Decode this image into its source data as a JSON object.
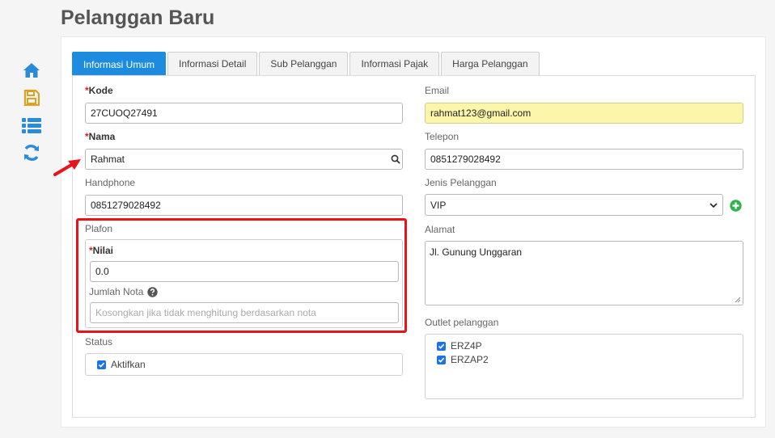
{
  "title": "Pelanggan Baru",
  "sidebar": {
    "icons": [
      "home-icon",
      "save-icon",
      "list-icon",
      "refresh-icon"
    ]
  },
  "tabs": [
    {
      "label": "Informasi Umum",
      "active": true
    },
    {
      "label": "Informasi Detail"
    },
    {
      "label": "Sub Pelanggan"
    },
    {
      "label": "Informasi Pajak"
    },
    {
      "label": "Harga Pelanggan"
    }
  ],
  "form": {
    "kode": {
      "label": "Kode",
      "value": "27CUOQ27491"
    },
    "nama": {
      "label": "Nama",
      "value": "Rahmat"
    },
    "handphone": {
      "label": "Handphone",
      "value": "0851279028492"
    },
    "plafon": {
      "label": "Plafon",
      "nilai": {
        "label": "Nilai",
        "value": "0.0"
      },
      "jumlah_nota": {
        "label": "Jumlah Nota",
        "placeholder": "Kosongkan jika tidak menghitung berdasarkan nota"
      }
    },
    "status": {
      "label": "Status",
      "checkbox_label": "Aktifkan",
      "checked": true
    },
    "email": {
      "label": "Email",
      "value": "rahmat123@gmail.com"
    },
    "telepon": {
      "label": "Telepon",
      "value": "0851279028492"
    },
    "jenis_pelanggan": {
      "label": "Jenis Pelanggan",
      "value": "VIP"
    },
    "alamat": {
      "label": "Alamat",
      "value": "Jl. Gunung Unggaran"
    },
    "outlet": {
      "label": "Outlet pelanggan",
      "items": [
        {
          "label": "ERZ4P",
          "checked": true
        },
        {
          "label": "ERZAP2",
          "checked": true
        }
      ]
    }
  },
  "required_mark": "*",
  "colors": {
    "accent": "#1d8ce0",
    "highlight": "#e8141b",
    "add": "#2db34a",
    "email_bg": "#fbf6aa"
  }
}
